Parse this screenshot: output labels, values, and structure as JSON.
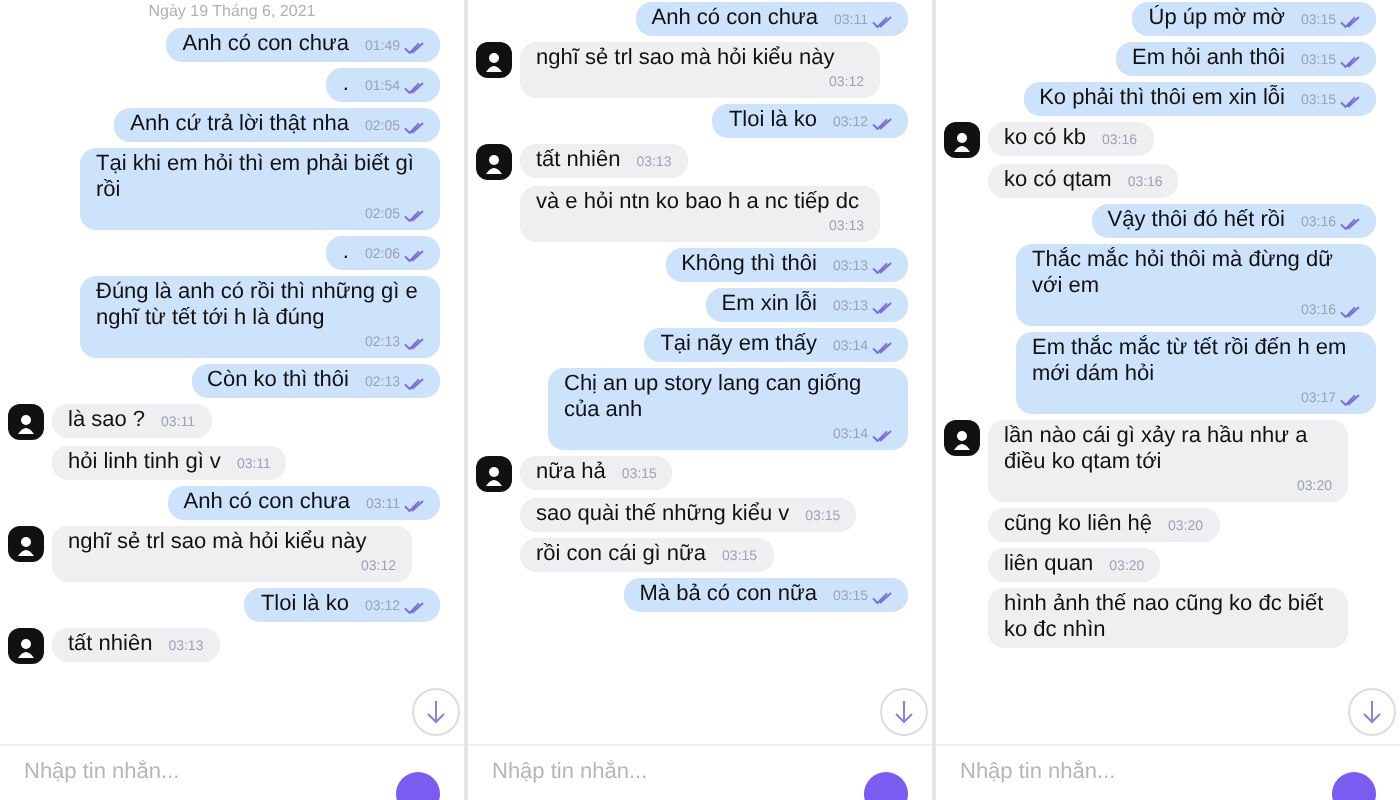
{
  "panels": [
    {
      "date": "Ngày 19 Tháng 6, 2021",
      "messages": [
        {
          "kind": "sent",
          "text": "Anh có con chưa",
          "time": "01:49"
        },
        {
          "kind": "sent",
          "text": ".",
          "time": "01:54"
        },
        {
          "kind": "sent",
          "text": "Anh cứ trả lời thật nha",
          "time": "02:05"
        },
        {
          "kind": "sent",
          "text": "Tại khi em hỏi thì em phải biết gì rồi",
          "time": "02:05"
        },
        {
          "kind": "sent",
          "text": ".",
          "time": "02:06"
        },
        {
          "kind": "sent",
          "text": "Đúng là anh có rồi thì những gì e nghĩ từ tết tới h là đúng",
          "time": "02:13"
        },
        {
          "kind": "sent",
          "text": "Còn ko thì thôi",
          "time": "02:13"
        },
        {
          "kind": "received",
          "avatar": true,
          "text": "là sao ?",
          "time": "03:11"
        },
        {
          "kind": "received",
          "avatar": false,
          "text": "hỏi linh tinh gì v",
          "time": "03:11"
        },
        {
          "kind": "sent",
          "text": "Anh có con chưa",
          "time": "03:11"
        },
        {
          "kind": "received",
          "avatar": true,
          "text": "nghĩ sẻ trl sao mà hỏi kiểu này",
          "time": "03:12"
        },
        {
          "kind": "sent",
          "text": "Tloi là ko",
          "time": "03:12"
        },
        {
          "kind": "received",
          "avatar": true,
          "text": "tất nhiên",
          "time": "03:13"
        }
      ],
      "input": {
        "placeholder": "Nhập tin nhắn..."
      }
    },
    {
      "messages": [
        {
          "kind": "sent",
          "text": "Anh có con chưa",
          "time": "03:11"
        },
        {
          "kind": "received",
          "avatar": true,
          "text": "nghĩ sẻ trl sao mà hỏi kiểu này",
          "time": "03:12"
        },
        {
          "kind": "sent",
          "text": "Tloi là ko",
          "time": "03:12"
        },
        {
          "kind": "received",
          "avatar": true,
          "text": "tất nhiên",
          "time": "03:13"
        },
        {
          "kind": "received",
          "avatar": false,
          "text": "và e hỏi ntn ko bao h a nc tiếp dc",
          "time": "03:13"
        },
        {
          "kind": "sent",
          "text": "Không thì thôi",
          "time": "03:13"
        },
        {
          "kind": "sent",
          "text": "Em xin lỗi",
          "time": "03:13"
        },
        {
          "kind": "sent",
          "text": "Tại nãy em thấy",
          "time": "03:14"
        },
        {
          "kind": "sent",
          "text": "Chị an up story lang can giống của anh",
          "time": "03:14"
        },
        {
          "kind": "received",
          "avatar": true,
          "text": "nữa hả",
          "time": "03:15"
        },
        {
          "kind": "received",
          "avatar": false,
          "text": "sao quài thế những kiểu v",
          "time": "03:15"
        },
        {
          "kind": "received",
          "avatar": false,
          "text": "rồi con cái gì nữa",
          "time": "03:15"
        },
        {
          "kind": "sent",
          "text": "Mà bả có con nữa",
          "time": "03:15"
        }
      ],
      "input": {
        "placeholder": "Nhập tin nhắn..."
      }
    },
    {
      "messages": [
        {
          "kind": "sent",
          "text": "Úp úp mờ mờ",
          "time": "03:15"
        },
        {
          "kind": "sent",
          "text": "Em hỏi anh thôi",
          "time": "03:15"
        },
        {
          "kind": "sent",
          "text": "Ko phải thì thôi em xin lỗi",
          "time": "03:15"
        },
        {
          "kind": "received",
          "avatar": true,
          "text": "ko có kb",
          "time": "03:16"
        },
        {
          "kind": "received",
          "avatar": false,
          "text": "ko có qtam",
          "time": "03:16"
        },
        {
          "kind": "sent",
          "text": "Vậy thôi đó hết rồi",
          "time": "03:16"
        },
        {
          "kind": "sent",
          "text": "Thắc mắc hỏi thôi mà đừng dữ với em",
          "time": "03:16"
        },
        {
          "kind": "sent",
          "text": "Em thắc mắc từ tết rồi đến h em mới dám hỏi",
          "time": "03:17"
        },
        {
          "kind": "received",
          "avatar": true,
          "text": "lần nào cái gì xảy ra hầu như a điều ko qtam tới",
          "time": "03:20"
        },
        {
          "kind": "received",
          "avatar": false,
          "text": "cũng ko liên hệ",
          "time": "03:20"
        },
        {
          "kind": "received",
          "avatar": false,
          "text": "liên quan",
          "time": "03:20"
        },
        {
          "kind": "received",
          "avatar": false,
          "text": "hình ảnh thế nao cũng ko đc biết ko đc nhìn"
        }
      ],
      "input": {
        "placeholder": "Nhập tin nhắn..."
      }
    }
  ]
}
